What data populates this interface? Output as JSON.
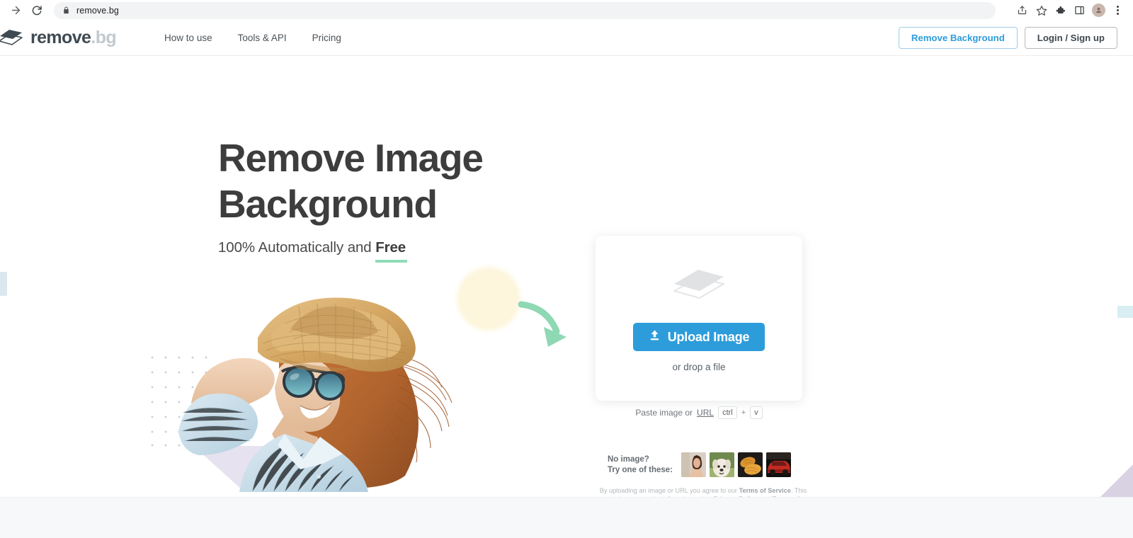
{
  "browser": {
    "url": "remove.bg",
    "icons": {
      "forward": "forward-arrow-icon",
      "reload": "reload-icon",
      "lock": "lock-icon",
      "share": "share-icon",
      "bookmark": "star-icon",
      "extensions": "puzzle-piece-icon",
      "sidepanel": "side-panel-icon",
      "profile": "profile-avatar-icon",
      "menu": "three-dot-menu-icon"
    }
  },
  "header": {
    "logo": {
      "primary": "remove",
      "secondary": ".bg",
      "icon": "layers-stack-logo-icon"
    },
    "nav": [
      {
        "label": "How to use"
      },
      {
        "label": "Tools & API"
      },
      {
        "label": "Pricing"
      }
    ],
    "remove_background_label": "Remove Background",
    "login_label": "Login / Sign up"
  },
  "hero": {
    "title_line1": "Remove Image",
    "title_line2": "Background",
    "subtitle_prefix": "100% Automatically and ",
    "subtitle_highlight": "Free"
  },
  "upload": {
    "button_label": "Upload Image",
    "upload_icon": "upload-arrow-icon",
    "drop_text": "or drop a file",
    "stack_icon": "layers-stack-icon",
    "paste_text": "Paste image or",
    "paste_link": "URL",
    "key_ctrl": "ctrl",
    "key_plus": "+",
    "key_v": "v"
  },
  "samples": {
    "line1": "No image?",
    "line2": "Try one of these:",
    "thumbs": [
      {
        "name": "woman-portrait-thumbnail"
      },
      {
        "name": "dog-thumbnail"
      },
      {
        "name": "croissant-thumbnail"
      },
      {
        "name": "red-car-thumbnail"
      }
    ]
  },
  "legal": {
    "part1": "By uploading an image or URL you agree to our ",
    "tos1": "Terms of Service",
    "part2": ". This site is protected by hCaptcha and its ",
    "privacy": "Privacy Policy",
    "part3": " and ",
    "tos2": "Terms of Service",
    "part4": " apply."
  },
  "colors": {
    "accent_blue": "#2d9cdb",
    "mint": "#8fdcb8",
    "heading": "#3d3d3d",
    "logo_light": "#c3c9cd"
  }
}
